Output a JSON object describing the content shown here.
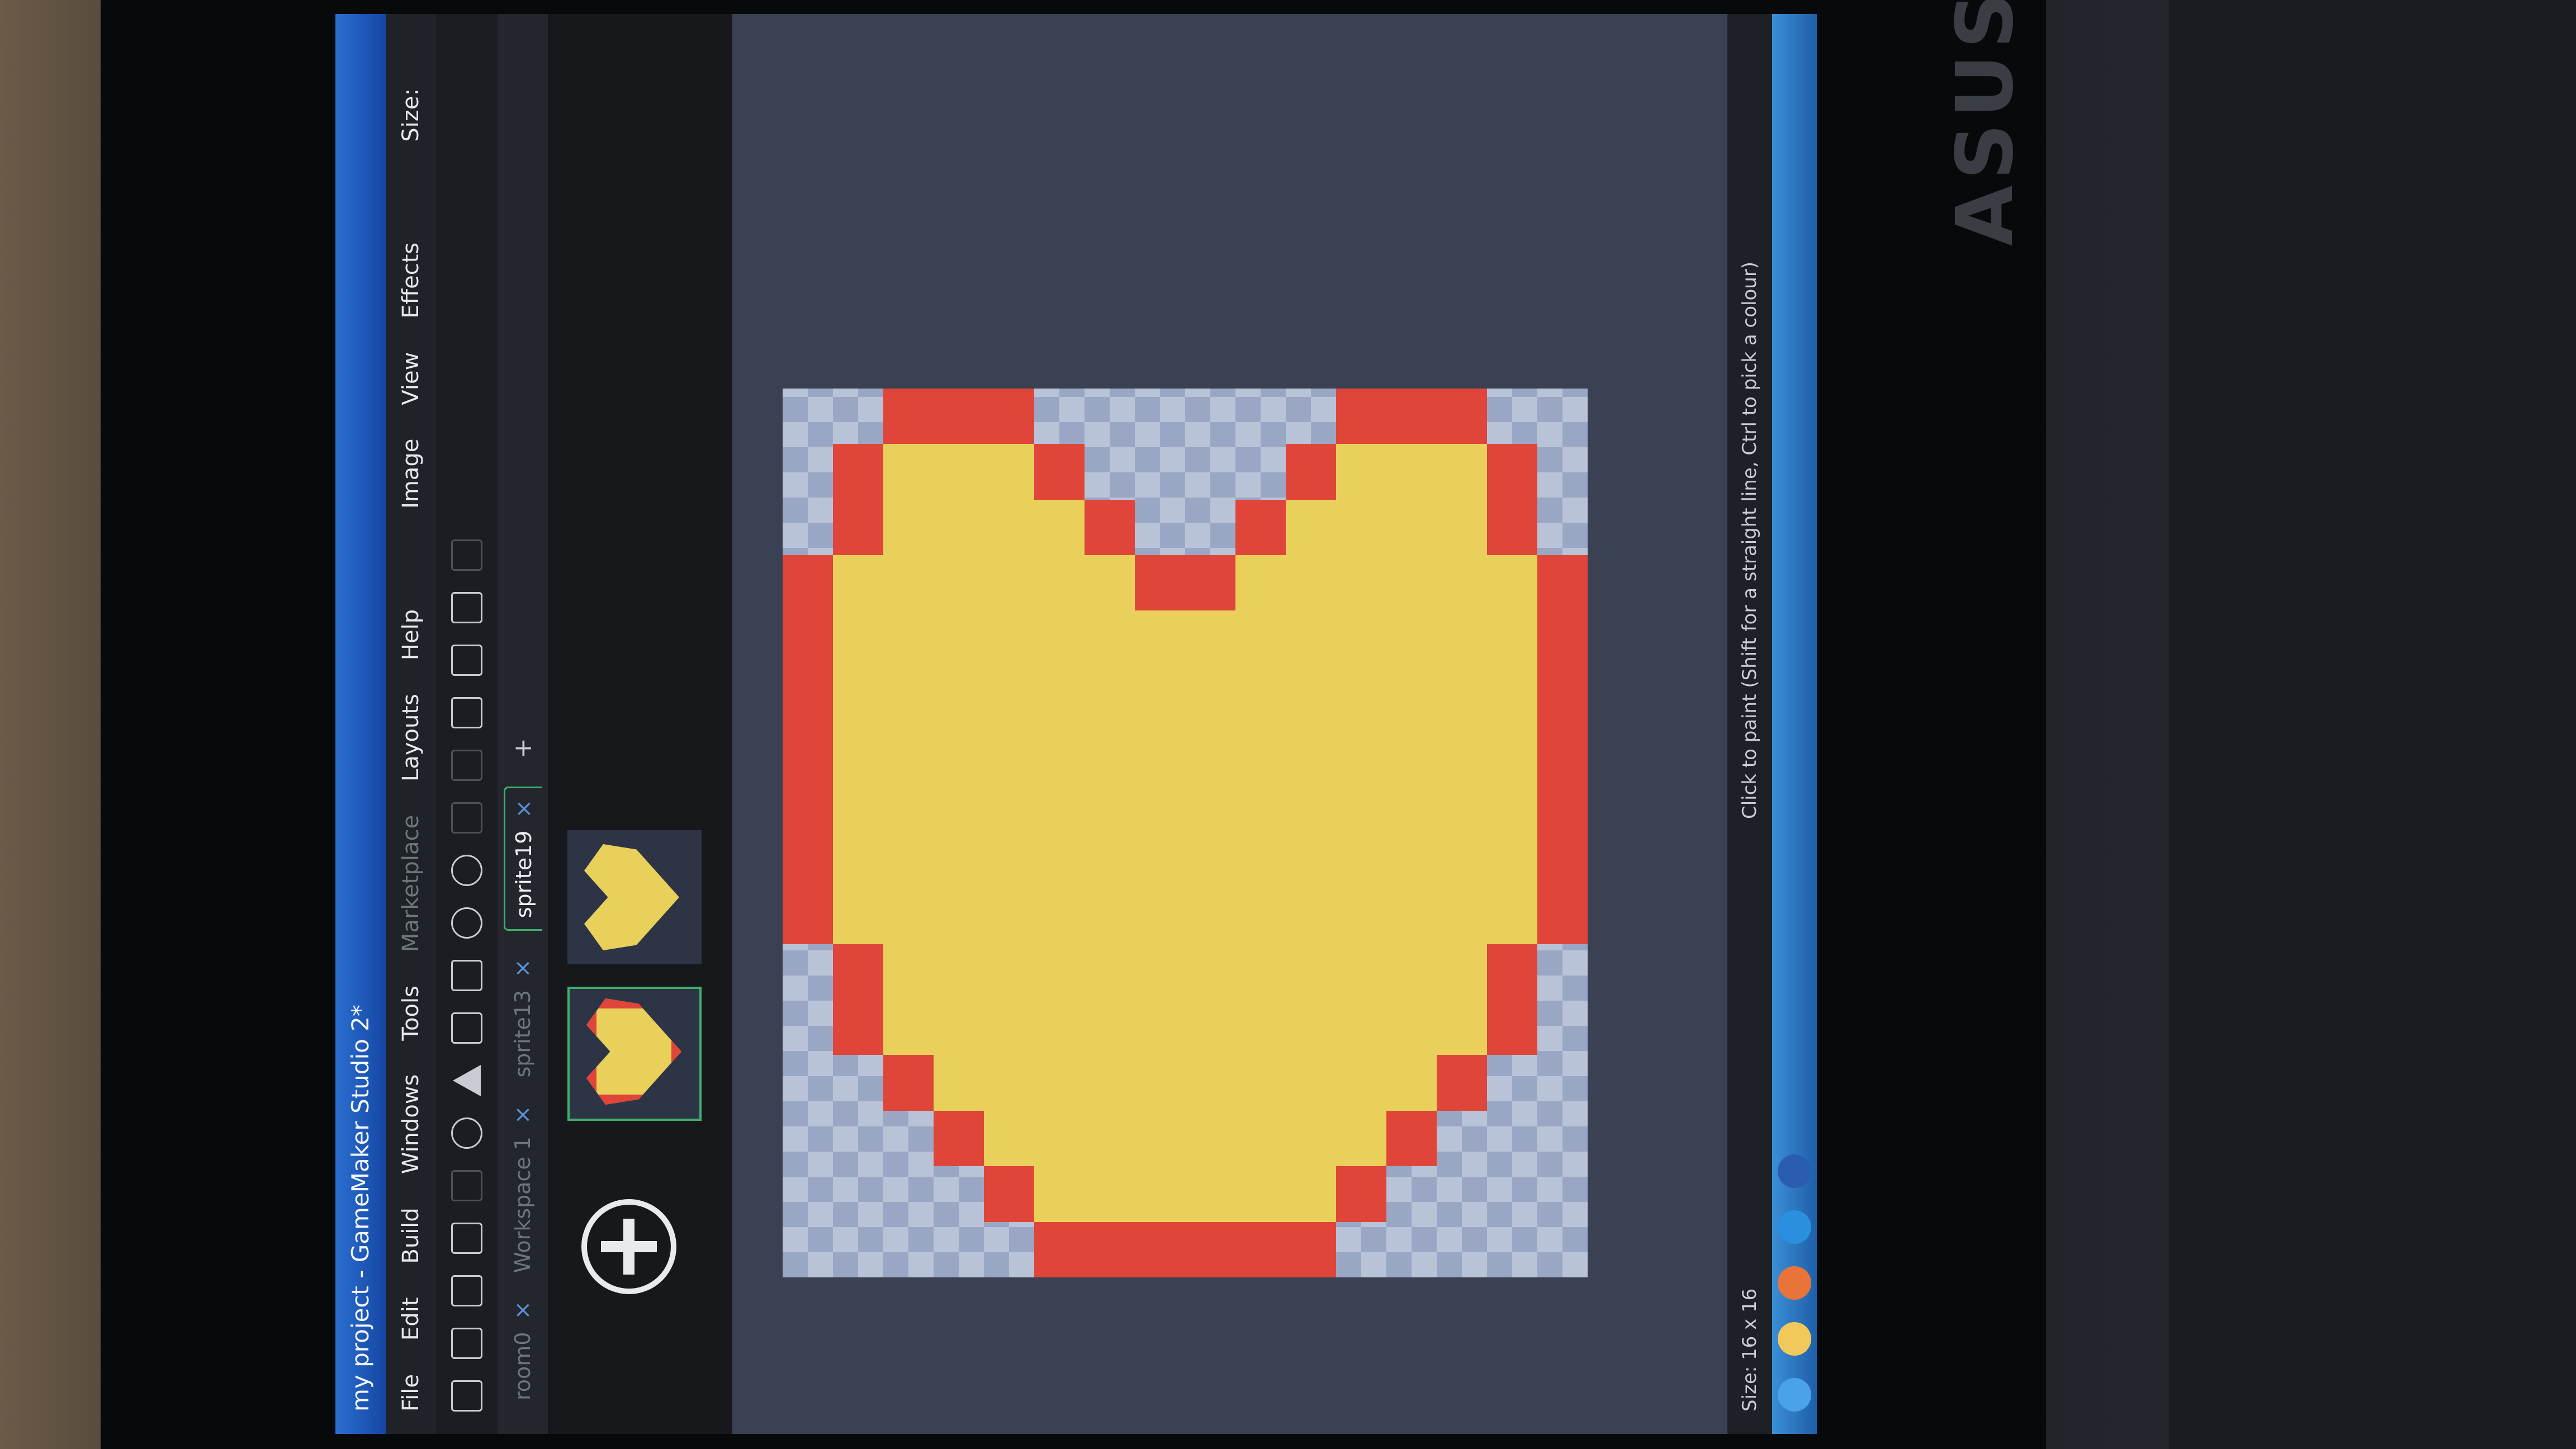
{
  "window": {
    "title": "my project - GameMaker Studio 2*"
  },
  "menu": [
    "File",
    "Edit",
    "Build",
    "Windows",
    "Tools",
    "Marketplace",
    "Layouts",
    "Help"
  ],
  "sprite_editor_menu": [
    "Image",
    "View",
    "Effects"
  ],
  "sprite_editor_tools": {
    "size_label": "Size:"
  },
  "tabs": [
    {
      "label": "room0",
      "active": false
    },
    {
      "label": "Workspace 1",
      "active": false
    },
    {
      "label": "sprite13",
      "active": false
    },
    {
      "label": "sprite19",
      "active": true
    }
  ],
  "frames": {
    "count": 2,
    "selected_index": 0
  },
  "canvas": {
    "grid": [
      "......RRRRRRR...",
      "....RRYYYYYYYRR.",
      "...RYYYYYYYYYYYR",
      "..RYYYYYYYYYYYYR",
      ".RYYYYYYYYYYYYYR",
      "RYYYYYYYYYYYYYR.",
      "RYYYYYYYYYYYYR..",
      "RYYYYYYYYYYYR...",
      "RYYYYYYYYYYYR...",
      "RYYYYYYYYYYYYR..",
      "RYYYYYYYYYYYYYR.",
      ".RYYYYYYYYYYYYYR",
      "..RYYYYYYYYYYYYR",
      "...RYYYYYYYYYYYR",
      "....RRYYYYYYYRR.",
      "......RRRRRRR..."
    ],
    "colors": {
      "R": "#e0453a",
      "Y": "#e9d05a"
    }
  },
  "status": {
    "size": "Size: 16 x 16",
    "hint": "Click to paint (Shift for a straight line, Ctrl to pick a colour)"
  },
  "taskbar": {
    "icons": [
      "windows-start-icon",
      "explorer-icon",
      "firefox-icon",
      "skype-icon",
      "word-icon"
    ]
  },
  "bezel_logo": "ASUS"
}
